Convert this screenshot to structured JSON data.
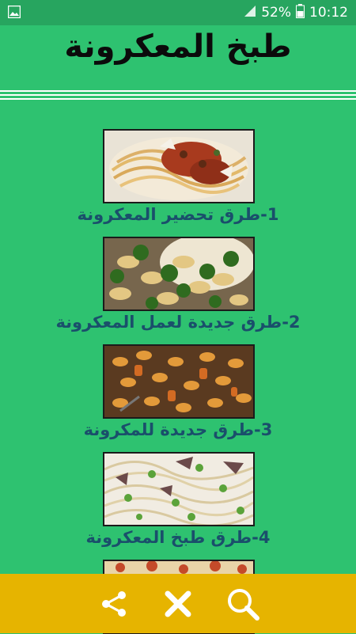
{
  "status_bar": {
    "battery": "52%",
    "time": "10:12"
  },
  "app": {
    "title": "طبخ المعكرونة"
  },
  "list": {
    "items": [
      {
        "label": "1-طرق تحضير المعكرونة",
        "image": "spaghetti-bolognese-image"
      },
      {
        "label": "2-طرق جديدة لعمل المعكرونة",
        "image": "rotini-broccoli-image"
      },
      {
        "label": "3-طرق جديدة للمكرونة",
        "image": "baked-pasta-image"
      },
      {
        "label": "4-طرق طبخ المعكرونة",
        "image": "spaghetti-peas-image"
      },
      {
        "label": "",
        "image": "pasta-image-partial"
      }
    ]
  },
  "bottom_bar": {
    "buttons": [
      "share-icon",
      "close-icon",
      "search-icon"
    ]
  },
  "colors": {
    "background": "#2ec270",
    "status_bar": "#27a55f",
    "bottom_bar": "#e6b400",
    "caption_text": "#1a4f6b"
  }
}
